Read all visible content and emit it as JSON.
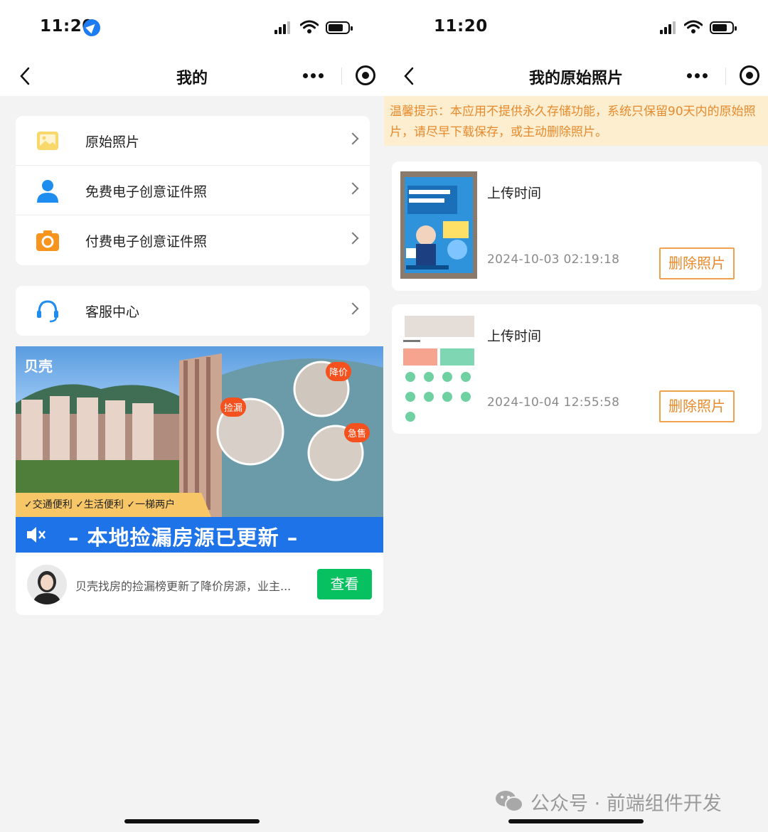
{
  "left_screen": {
    "status_time": "11:20",
    "nav_title": "我的",
    "menu_items": [
      {
        "label": "原始照片"
      },
      {
        "label": "免费电子创意证件照"
      },
      {
        "label": "付费电子创意证件照"
      }
    ],
    "service_item": {
      "label": "客服中心"
    },
    "ad": {
      "brand": "贝壳",
      "tags": [
        "✓交通便利",
        "✓生活便利",
        "✓一梯两户"
      ],
      "badges": [
        "降价",
        "捡漏",
        "急售"
      ],
      "headline": "– 本地捡漏房源已更新 –",
      "footer_text": "贝壳找房的捡漏榜更新了降价房源，业主...",
      "view_button": "查看"
    }
  },
  "right_screen": {
    "status_time": "11:20",
    "nav_title": "我的原始照片",
    "tip": "温馨提示：本应用不提供永久存储功能，系统只保留90天内的原始照片，请尽早下载保存，或主动删除照片。",
    "photos": [
      {
        "label": "上传时间",
        "time": "2024-10-03 02:19:18",
        "delete_button": "删除照片"
      },
      {
        "label": "上传时间",
        "time": "2024-10-04 12:55:58",
        "delete_button": "删除照片"
      }
    ]
  },
  "watermark": "公众号 · 前端组件开发",
  "colors": {
    "accent_green": "#07c160",
    "tip_bg": "#fdeecf",
    "tip_text": "#e78a2d",
    "delete_orange": "#e88a2b",
    "location_blue": "#1e7cf2"
  }
}
